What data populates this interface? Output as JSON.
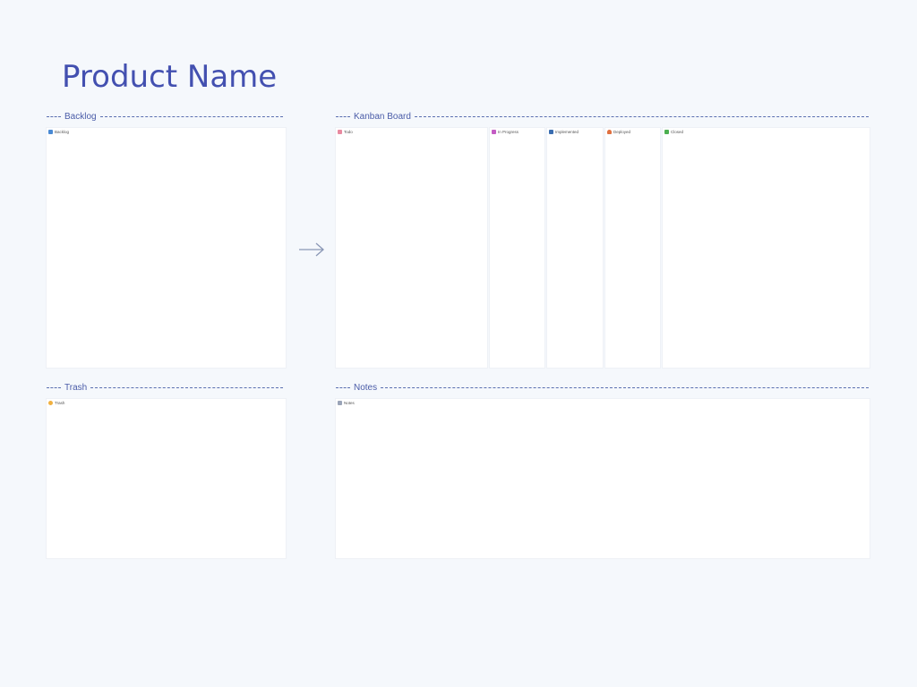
{
  "page": {
    "title": "Product Name"
  },
  "sections": {
    "backlog": "Backlog",
    "kanban": "Kanban Board",
    "trash": "Trash",
    "notes": "Notes"
  },
  "panels": {
    "backlog": {
      "label": "Backlog",
      "icon": "folder-icon"
    },
    "trash": {
      "label": "Trash",
      "icon": "trash-icon"
    },
    "notes": {
      "label": "Notes",
      "icon": "notes-icon"
    }
  },
  "kanban": {
    "columns": [
      {
        "label": "Todo",
        "icon": "todo-icon"
      },
      {
        "label": "In Progress",
        "icon": "rocket-icon"
      },
      {
        "label": "Implemented",
        "icon": "chart-icon"
      },
      {
        "label": "Deployed",
        "icon": "person-icon"
      },
      {
        "label": "Closed",
        "icon": "check-icon"
      }
    ]
  },
  "colors": {
    "title": "#4350b0",
    "background": "#f5f8fc",
    "dash": "#5a6fb0"
  }
}
